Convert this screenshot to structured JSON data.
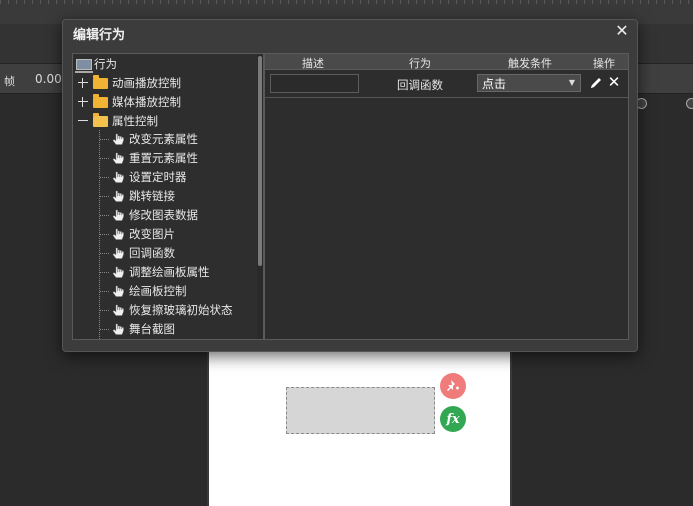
{
  "background": {
    "frame_label": "帧",
    "frame_value": "0.00"
  },
  "dialog": {
    "title": "编辑行为",
    "close_glyph": "✕"
  },
  "tree": {
    "root_label": "行为",
    "groups": [
      {
        "label": "动画播放控制",
        "expanded": false
      },
      {
        "label": "媒体播放控制",
        "expanded": false
      },
      {
        "label": "属性控制",
        "expanded": true
      }
    ],
    "items": [
      "改变元素属性",
      "重置元素属性",
      "设置定时器",
      "跳转链接",
      "修改图表数据",
      "改变图片",
      "回调函数",
      "调整绘画板属性",
      "绘画板控制",
      "恢复擦玻璃初始状态",
      "舞台截图"
    ]
  },
  "table": {
    "headers": {
      "description": "描述",
      "action": "行为",
      "trigger": "触发条件",
      "operation": "操作"
    },
    "rows": [
      {
        "description": "",
        "action": "回调函数",
        "trigger": "点击"
      }
    ]
  },
  "icons": {
    "expander_plus": "plus-expander",
    "expander_minus": "minus-expander",
    "folder": "folder-icon",
    "hand": "hand-pointer-icon",
    "edit": "pencil-icon",
    "delete": "close-icon",
    "stage_pin": "pin-plus-icon",
    "stage_fx": "fx-icon"
  },
  "stage": {
    "fx_text": "fx"
  },
  "colors": {
    "dialog_bg": "#3c3c3c",
    "panel_bg": "#2e2e2e",
    "header_bg": "#4a4a4a",
    "folder": "#f2b233",
    "badge_pin": "#f07b7b",
    "badge_fx": "#32a852"
  }
}
